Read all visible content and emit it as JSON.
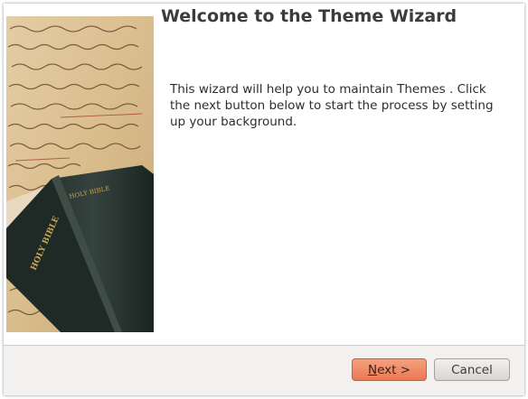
{
  "wizard": {
    "title": "Welcome to the Theme Wizard",
    "description": "This wizard will help you to maintain Themes . Click the next button below to start the process by setting up your background."
  },
  "side_image": {
    "name": "bible-on-manuscript-image",
    "book_spine_text": "HOLY BIBLE",
    "book_cover_text": "HOLY BIBLE"
  },
  "buttons": {
    "next_mnemonic": "N",
    "next_rest": "ext >",
    "cancel_label": "Cancel"
  },
  "colors": {
    "next_button": "#ee8660",
    "cancel_button": "#e4e2df",
    "button_bar": "#f2f1f0"
  }
}
